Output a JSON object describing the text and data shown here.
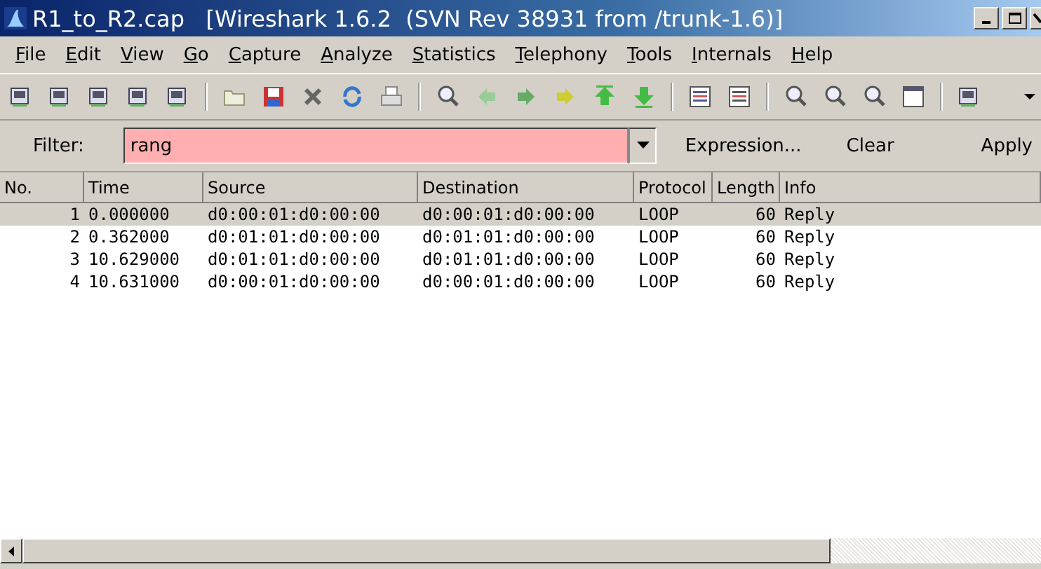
{
  "window": {
    "title": "R1_to_R2.cap   [Wireshark 1.6.2  (SVN Rev 38931 from /trunk-1.6)]"
  },
  "menu": [
    "File",
    "Edit",
    "View",
    "Go",
    "Capture",
    "Analyze",
    "Statistics",
    "Telephony",
    "Tools",
    "Internals",
    "Help"
  ],
  "filter": {
    "label": "Filter:",
    "value": "rang",
    "invalid": true,
    "buttons": [
      "Expression...",
      "Clear",
      "Apply"
    ]
  },
  "table": {
    "columns": [
      "No.",
      "Time",
      "Source",
      "Destination",
      "Protocol",
      "Length",
      "Info"
    ],
    "rows": [
      {
        "cells": [
          "1",
          "0.000000",
          "d0:00:01:d0:00:00",
          "d0:00:01:d0:00:00",
          "LOOP",
          "60",
          "Reply"
        ],
        "selected": true
      },
      {
        "cells": [
          "2",
          "0.362000",
          "d0:01:01:d0:00:00",
          "d0:01:01:d0:00:00",
          "LOOP",
          "60",
          "Reply"
        ],
        "selected": false
      },
      {
        "cells": [
          "3",
          "10.629000",
          "d0:01:01:d0:00:00",
          "d0:01:01:d0:00:00",
          "LOOP",
          "60",
          "Reply"
        ],
        "selected": false
      },
      {
        "cells": [
          "4",
          "10.631000",
          "d0:00:01:d0:00:00",
          "d0:00:01:d0:00:00",
          "LOOP",
          "60",
          "Reply"
        ],
        "selected": false
      }
    ]
  }
}
